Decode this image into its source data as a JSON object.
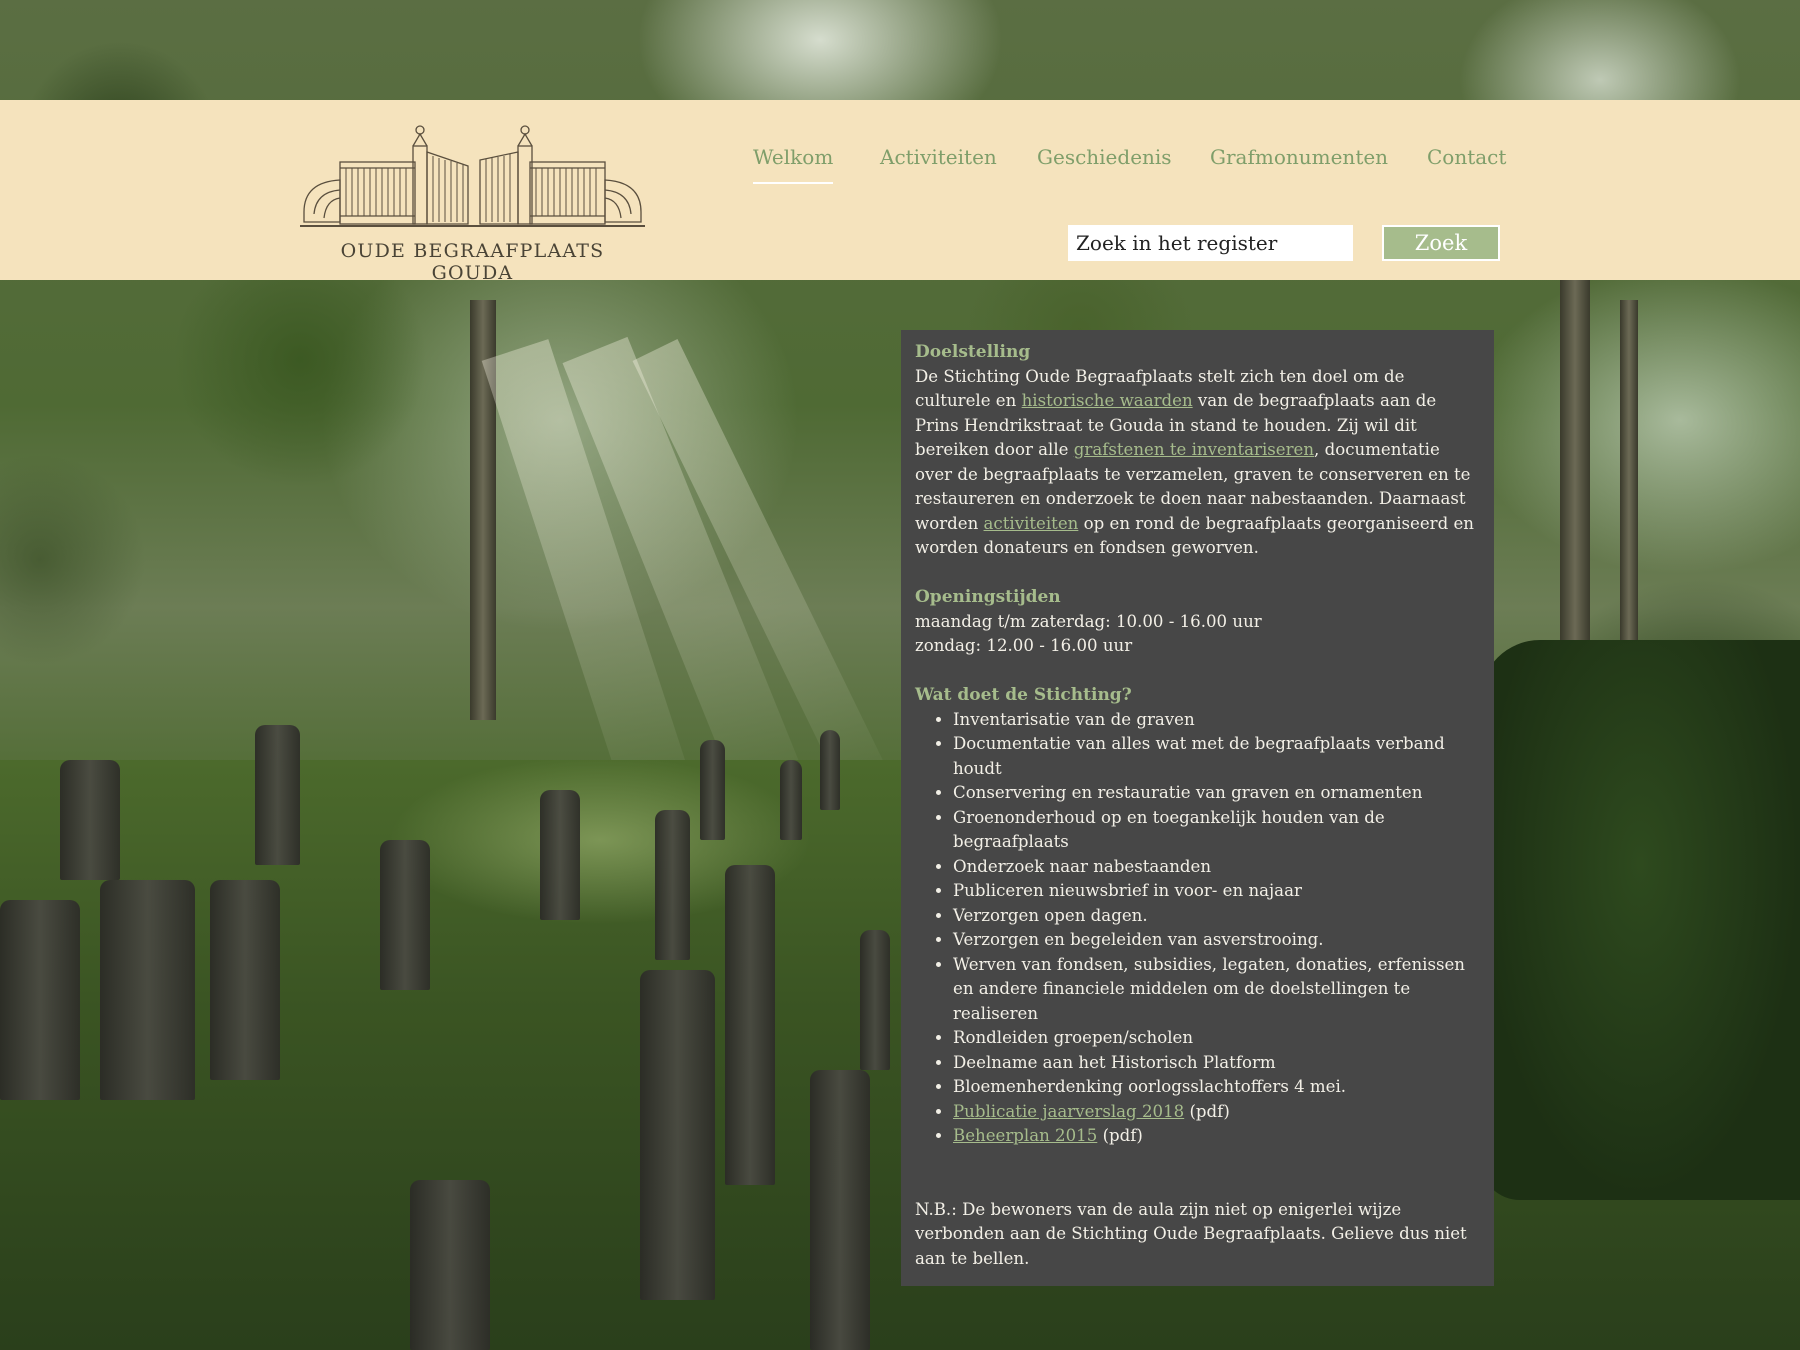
{
  "logo": {
    "text": "OUDE BEGRAAFPLAATS GOUDA",
    "icon": "cemetery-gate-logo"
  },
  "nav": {
    "items": [
      {
        "label": "Welkom",
        "active": true
      },
      {
        "label": "Activiteiten",
        "active": false
      },
      {
        "label": "Geschiedenis",
        "active": false
      },
      {
        "label": "Grafmonumenten",
        "active": false
      },
      {
        "label": "Contact",
        "active": false
      }
    ]
  },
  "search": {
    "value": "Zoek in het register",
    "button_label": "Zoek"
  },
  "colors": {
    "header_bg": "#f5e3bd",
    "accent_green": "#a6bc8c",
    "nav_green": "#7f9e6a",
    "panel_bg": "#474747"
  },
  "content": {
    "doelstelling": {
      "heading": "Doelstelling",
      "t1": "De Stichting Oude Begraafplaats stelt zich ten doel om de culturele en ",
      "link1": "historische waarden",
      "t2": " van de begraafplaats aan de Prins Hendrikstraat te Gouda in stand te houden. Zij wil dit bereiken door alle ",
      "link2": "grafstenen te inventariseren",
      "t3": ", documentatie over de begraafplaats te verzamelen, graven te conserveren en te restaureren en onderzoek te doen naar nabestaanden. Daarnaast worden ",
      "link3": "activiteiten",
      "t4": " op en rond de begraafplaats georganiseerd en worden donateurs en fondsen geworven."
    },
    "openingstijden": {
      "heading": "Openingstijden",
      "line1": "maandag t/m zaterdag: 10.00 - 16.00 uur",
      "line2": "zondag: 12.00 - 16.00 uur"
    },
    "stichting": {
      "heading": "Wat doet de Stichting?",
      "items": [
        "Inventarisatie van de graven",
        "Documentatie van alles wat met de begraafplaats verband houdt",
        "Conservering en restauratie van graven en ornamenten",
        "Groenonderhoud op en toegankelijk houden van de begraafplaats",
        "Onderzoek naar nabestaanden",
        "Publiceren nieuwsbrief in voor- en najaar",
        "Verzorgen open dagen.",
        "Verzorgen en begeleiden van asverstrooing.",
        "Werven van fondsen, subsidies, legaten, donaties, erfenissen en andere financiele middelen om de doelstellingen te realiseren",
        "Rondleiden groepen/scholen",
        "Deelname aan het Historisch Platform",
        "Bloemenherdenking oorlogsslachtoffers 4 mei."
      ],
      "link_items": [
        {
          "link": "Publicatie jaarverslag 2018",
          "suffix": " (pdf)"
        },
        {
          "link": "Beheerplan 2015",
          "suffix": " (pdf)"
        }
      ]
    },
    "note": "N.B.: De bewoners van de aula zijn niet op enigerlei wijze verbonden aan de Stichting Oude Begraafplaats. Gelieve dus niet aan te bellen."
  }
}
